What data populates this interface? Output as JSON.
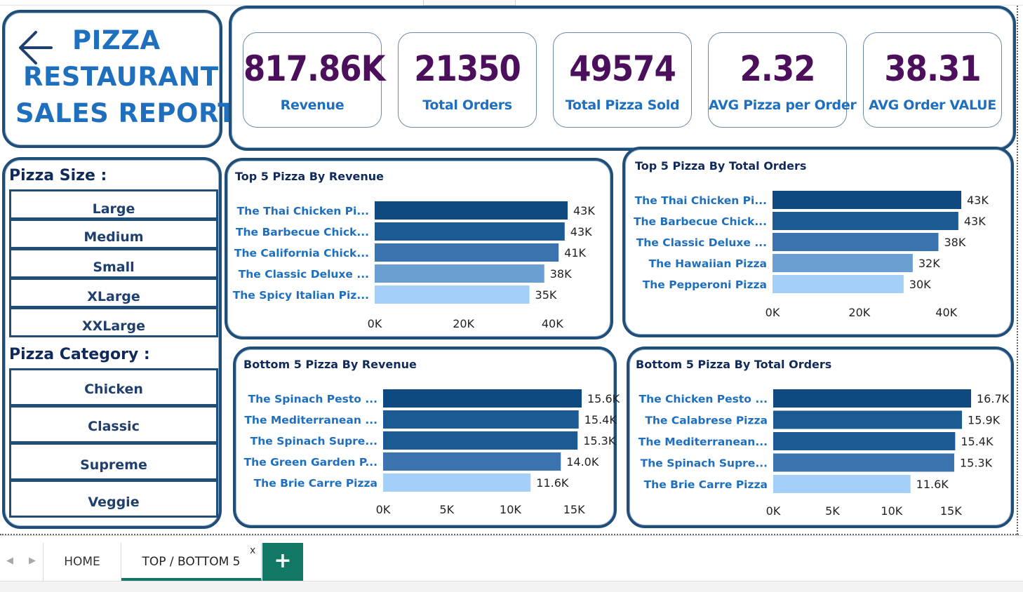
{
  "title": {
    "line1": "PIZZA",
    "line2": "RESTAURANT",
    "line3": "SALES REPORT"
  },
  "kpis": [
    {
      "value": "817.86K",
      "label": "Revenue"
    },
    {
      "value": "21350",
      "label": "Total Orders"
    },
    {
      "value": "49574",
      "label": "Total Pizza Sold"
    },
    {
      "value": "2.32",
      "label": "AVG Pizza per Order"
    },
    {
      "value": "38.31",
      "label": "AVG Order VALUE"
    }
  ],
  "slicers": {
    "size_title": "Pizza Size :",
    "sizes": [
      "Large",
      "Medium",
      "Small",
      "XLarge",
      "XXLarge"
    ],
    "category_title": "Pizza Category :",
    "categories": [
      "Chicken",
      "Classic",
      "Supreme",
      "Veggie"
    ]
  },
  "colors": {
    "panel_border": "#1f4e79",
    "title_blue": "#1f6fbf",
    "kpi_value": "#4b0f5c",
    "bar_shades": [
      "#0e4a80",
      "#1c5a94",
      "#3a73ad",
      "#6b9fd4",
      "#a4cff8"
    ],
    "tab_green": "#117865"
  },
  "chart_data": [
    {
      "type": "bar",
      "orientation": "horizontal",
      "title": "Top 5 Pizza By Revenue",
      "categories": [
        "The Thai Chicken Pi...",
        "The Barbecue Chick...",
        "The California Chick...",
        "The Classic Deluxe ...",
        "The Spicy Italian Piz..."
      ],
      "values": [
        43434,
        42768,
        41410,
        38180,
        34831
      ],
      "data_labels": [
        "43K",
        "43K",
        "41K",
        "38K",
        "35K"
      ],
      "xlim": [
        0,
        43434
      ],
      "ticks": [
        0,
        20000,
        40000
      ],
      "tick_labels": [
        "0K",
        "20K",
        "40K"
      ]
    },
    {
      "type": "bar",
      "orientation": "horizontal",
      "title": "Top 5 Pizza By Total Orders",
      "categories": [
        "The Thai Chicken Pi...",
        "The Barbecue Chick...",
        "The Classic Deluxe ...",
        "The Hawaiian Pizza",
        "The Pepperoni Pizza"
      ],
      "values": [
        43434,
        42768,
        38180,
        32273,
        30161
      ],
      "data_labels": [
        "43K",
        "43K",
        "38K",
        "32K",
        "30K"
      ],
      "xlim": [
        0,
        43434
      ],
      "ticks": [
        0,
        20000,
        40000
      ],
      "tick_labels": [
        "0K",
        "20K",
        "40K"
      ]
    },
    {
      "type": "bar",
      "orientation": "horizontal",
      "title": "Bottom 5 Pizza By Revenue",
      "categories": [
        "The Spinach Pesto ...",
        "The Mediterranean ...",
        "The Spinach Supre...",
        "The Green Garden P...",
        "The Brie Carre Pizza"
      ],
      "values": [
        15596,
        15360,
        15277,
        13956,
        11588
      ],
      "data_labels": [
        "15.6K",
        "15.4K",
        "15.3K",
        "14.0K",
        "11.6K"
      ],
      "xlim": [
        0,
        15596
      ],
      "ticks": [
        0,
        5000,
        10000,
        15000
      ],
      "tick_labels": [
        "0K",
        "5K",
        "10K",
        "15K"
      ]
    },
    {
      "type": "bar",
      "orientation": "horizontal",
      "title": "Bottom 5 Pizza By Total Orders",
      "categories": [
        "The Chicken Pesto ...",
        "The Calabrese Pizza",
        "The Mediterranean...",
        "The Spinach Supre...",
        "The Brie Carre Pizza"
      ],
      "values": [
        16701,
        15934,
        15360,
        15277,
        11588
      ],
      "data_labels": [
        "16.7K",
        "15.9K",
        "15.4K",
        "15.3K",
        "11.6K"
      ],
      "xlim": [
        0,
        16701
      ],
      "ticks": [
        0,
        5000,
        10000,
        15000
      ],
      "tick_labels": [
        "0K",
        "5K",
        "10K",
        "15K"
      ]
    }
  ],
  "sheet_tabs": {
    "home": "HOME",
    "active": "TOP / BOTTOM 5",
    "close": "x",
    "add": "+",
    "nav_prev": "◀",
    "nav_next": "▶"
  }
}
